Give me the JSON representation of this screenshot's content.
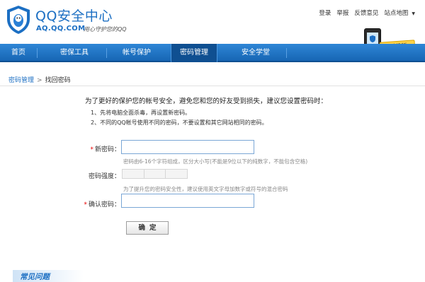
{
  "header": {
    "title": "QQ安全中心",
    "domain": "AQ.QQ.COM",
    "slogan": "用心守护您的QQ",
    "links": [
      "登录",
      "举报",
      "反馈意见",
      "站点地图"
    ],
    "mobile_badge": "手机版"
  },
  "nav": {
    "items": [
      {
        "label": "首页"
      },
      {
        "label": "密保工具"
      },
      {
        "label": "帐号保护"
      },
      {
        "label": "密码管理",
        "active": true
      },
      {
        "label": "安全学堂"
      }
    ]
  },
  "breadcrumb": {
    "parent": "密码管理",
    "current": "找回密码"
  },
  "content": {
    "intro": "为了更好的保护您的帐号安全，避免您和您的好友受到损失，建议您设置密码时：",
    "tips": [
      "1、先将电脑全面杀毒，再设置新密码。",
      "2、不同的QQ帐号使用不同的密码，不要设置和其它网站相同的密码。"
    ]
  },
  "form": {
    "new_password_label": "新密码：",
    "new_password_hint": "密码由6-16个字符组成，区分大小写(不能是9位以下的纯数字，不能包含空格)",
    "strength_label": "密码强度：",
    "strength_hint": "为了提升您的密码安全性，建议使用英文字母加数字或符号的混合密码",
    "confirm_label": "确认密码：",
    "submit": "确定"
  },
  "faq": {
    "title": "常见问题"
  },
  "colors": {
    "brand": "#1c6fc3",
    "nav_bg": "#1766b4",
    "nav_active": "#0f4f91",
    "required_star": "#e60000"
  }
}
